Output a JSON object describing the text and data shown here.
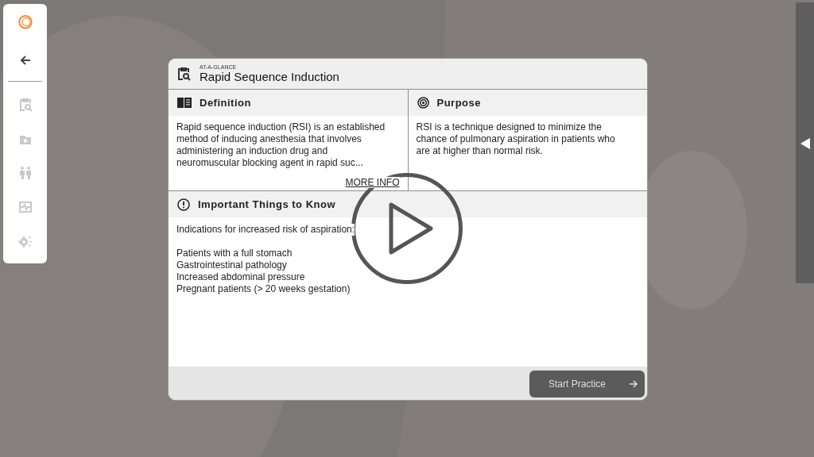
{
  "sidebar": {
    "items": [
      {
        "kind": "back",
        "disabled": false
      },
      {
        "kind": "clipboard-search",
        "disabled": true
      },
      {
        "kind": "folder-plus",
        "disabled": true
      },
      {
        "kind": "people",
        "disabled": true
      },
      {
        "kind": "monitor",
        "disabled": true
      },
      {
        "kind": "gear",
        "disabled": true
      }
    ]
  },
  "card": {
    "eyebrow": "AT-A-GLANCE",
    "title": "Rapid Sequence Induction",
    "definition": {
      "heading": "Definition",
      "text": "Rapid sequence induction (RSI) is an established method of inducing anesthesia that involves administering an induction drug and neuromuscular blocking agent in rapid suc...",
      "link": "MORE INFO"
    },
    "purpose": {
      "heading": "Purpose",
      "text": "RSI is a technique designed to minimize the chance of pulmonary aspiration in patients who are at higher than normal risk."
    },
    "important": {
      "heading": "Important Things to Know",
      "intro": "Indications for increased risk of aspiration:",
      "items": [
        "Patients with a full stomach",
        "Gastrointestinal pathology",
        "Increased abdominal pressure",
        "Pregnant patients (> 20 weeks gestation)"
      ]
    },
    "button": "Start Practice"
  }
}
